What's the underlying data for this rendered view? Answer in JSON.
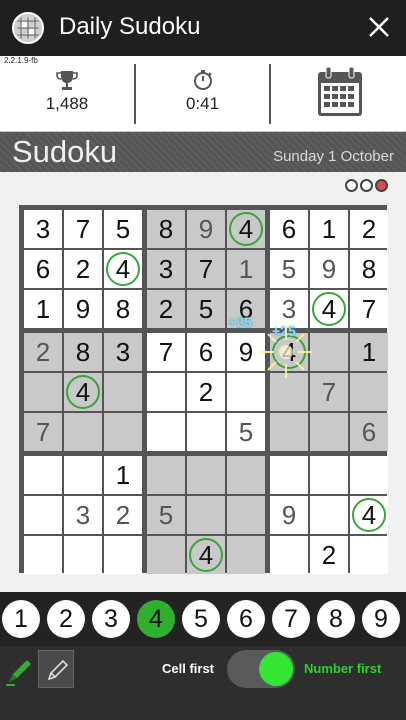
{
  "app": {
    "title": "Daily Sudoku",
    "version": "2.2.1.9-fb"
  },
  "stats": {
    "score": "1,488",
    "time": "0:41"
  },
  "heading": {
    "title": "Sudoku",
    "date": "Sunday 1 October"
  },
  "lives": {
    "total": 3,
    "lost": 1
  },
  "board": [
    [
      3,
      7,
      5,
      8,
      9,
      4,
      6,
      1,
      2
    ],
    [
      6,
      2,
      4,
      3,
      7,
      1,
      5,
      9,
      8
    ],
    [
      1,
      9,
      8,
      2,
      5,
      6,
      3,
      4,
      7
    ],
    [
      2,
      8,
      3,
      7,
      6,
      9,
      4,
      0,
      1
    ],
    [
      0,
      4,
      0,
      0,
      2,
      0,
      0,
      7,
      0
    ],
    [
      7,
      0,
      0,
      0,
      0,
      5,
      0,
      0,
      6
    ],
    [
      0,
      0,
      1,
      0,
      0,
      0,
      0,
      0,
      0
    ],
    [
      0,
      3,
      2,
      5,
      0,
      0,
      9,
      0,
      4
    ],
    [
      0,
      0,
      0,
      0,
      4,
      0,
      0,
      2,
      0
    ]
  ],
  "dim_digits": [
    [
      0,
      4
    ],
    [
      1,
      5
    ],
    [
      1,
      6
    ],
    [
      1,
      7
    ],
    [
      2,
      6
    ],
    [
      3,
      0
    ],
    [
      4,
      7
    ],
    [
      5,
      0
    ],
    [
      5,
      5
    ],
    [
      5,
      8
    ],
    [
      7,
      1
    ],
    [
      7,
      2
    ],
    [
      7,
      3
    ],
    [
      7,
      6
    ]
  ],
  "highlighted_digit": 4,
  "effects": {
    "bonus_1": "+25",
    "bonus_2": "+25"
  },
  "numpad": [
    "1",
    "2",
    "3",
    "4",
    "5",
    "6",
    "7",
    "8",
    "9"
  ],
  "selected_number": "4",
  "input_mode": {
    "left_label": "Cell first",
    "right_label": "Number first",
    "active": "Number first"
  },
  "colors": {
    "accent_green": "#2fae2f",
    "toggle_green": "#33e633",
    "life_lost": "#e04a4a",
    "shaded_cell": "#c9c9c9"
  }
}
